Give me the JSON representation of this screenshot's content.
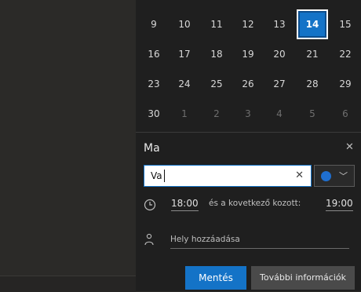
{
  "calendar": {
    "rows": [
      [
        {
          "d": "9"
        },
        {
          "d": "10"
        },
        {
          "d": "11"
        },
        {
          "d": "12"
        },
        {
          "d": "13"
        },
        {
          "d": "14",
          "today": true
        },
        {
          "d": "15"
        }
      ],
      [
        {
          "d": "16"
        },
        {
          "d": "17"
        },
        {
          "d": "18"
        },
        {
          "d": "19"
        },
        {
          "d": "20"
        },
        {
          "d": "21"
        },
        {
          "d": "22"
        }
      ],
      [
        {
          "d": "23"
        },
        {
          "d": "24"
        },
        {
          "d": "25"
        },
        {
          "d": "26"
        },
        {
          "d": "27"
        },
        {
          "d": "28"
        },
        {
          "d": "29"
        }
      ],
      [
        {
          "d": "30"
        },
        {
          "d": "1",
          "dim": true
        },
        {
          "d": "2",
          "dim": true
        },
        {
          "d": "3",
          "dim": true
        },
        {
          "d": "4",
          "dim": true
        },
        {
          "d": "5",
          "dim": true
        },
        {
          "d": "6",
          "dim": true
        }
      ]
    ]
  },
  "event": {
    "day_label": "Ma",
    "title_value": "Va",
    "color": "#1f6fd0"
  },
  "time": {
    "start": "18:00",
    "between_text": "és a kovetkező kozott:",
    "end": "19:00"
  },
  "location": {
    "placeholder": "Hely hozzáadása"
  },
  "buttons": {
    "save": "Mentés",
    "more": "További információk"
  },
  "icons": {
    "close": "close-icon",
    "clear": "clear-icon",
    "clock": "clock-icon",
    "person": "person-icon",
    "chevron": "chevron-down-icon"
  },
  "colors": {
    "accent": "#1473c7",
    "panel_bg": "#1f1f1f",
    "left_bg": "#2b2a28"
  }
}
